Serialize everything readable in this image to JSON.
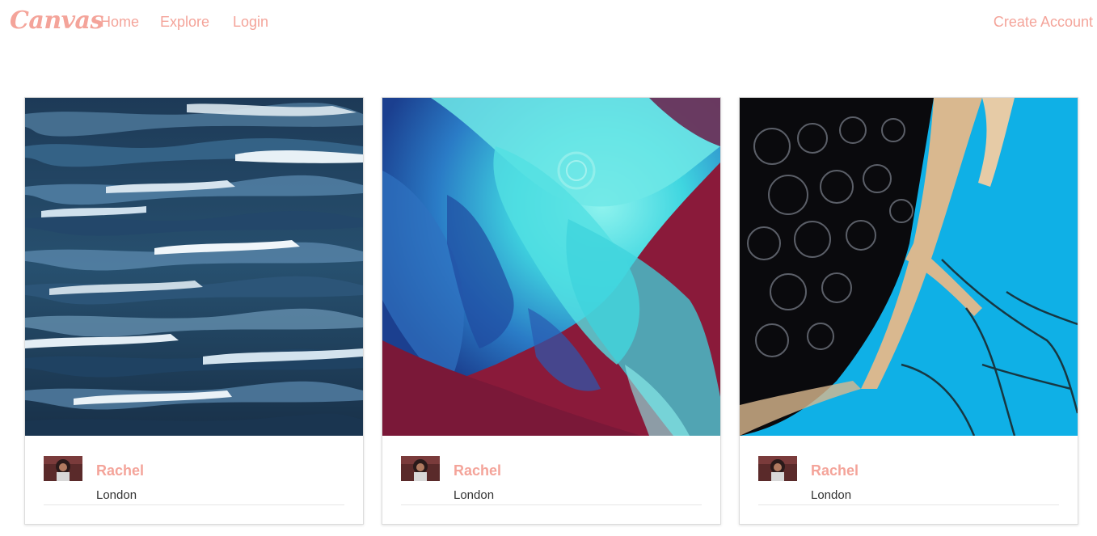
{
  "nav": {
    "brand": "Canvas",
    "home": "Home",
    "explore": "Explore",
    "login": "Login",
    "create_account": "Create Account",
    "accent_color": "#f4a49a"
  },
  "cards": [
    {
      "artist": "Rachel",
      "location": "London",
      "image": "blue-abstract-painting"
    },
    {
      "artist": "Rachel",
      "location": "London",
      "image": "turquoise-red-abstract-painting"
    },
    {
      "artist": "Rachel",
      "location": "London",
      "image": "black-blue-gold-fluid-painting"
    }
  ]
}
